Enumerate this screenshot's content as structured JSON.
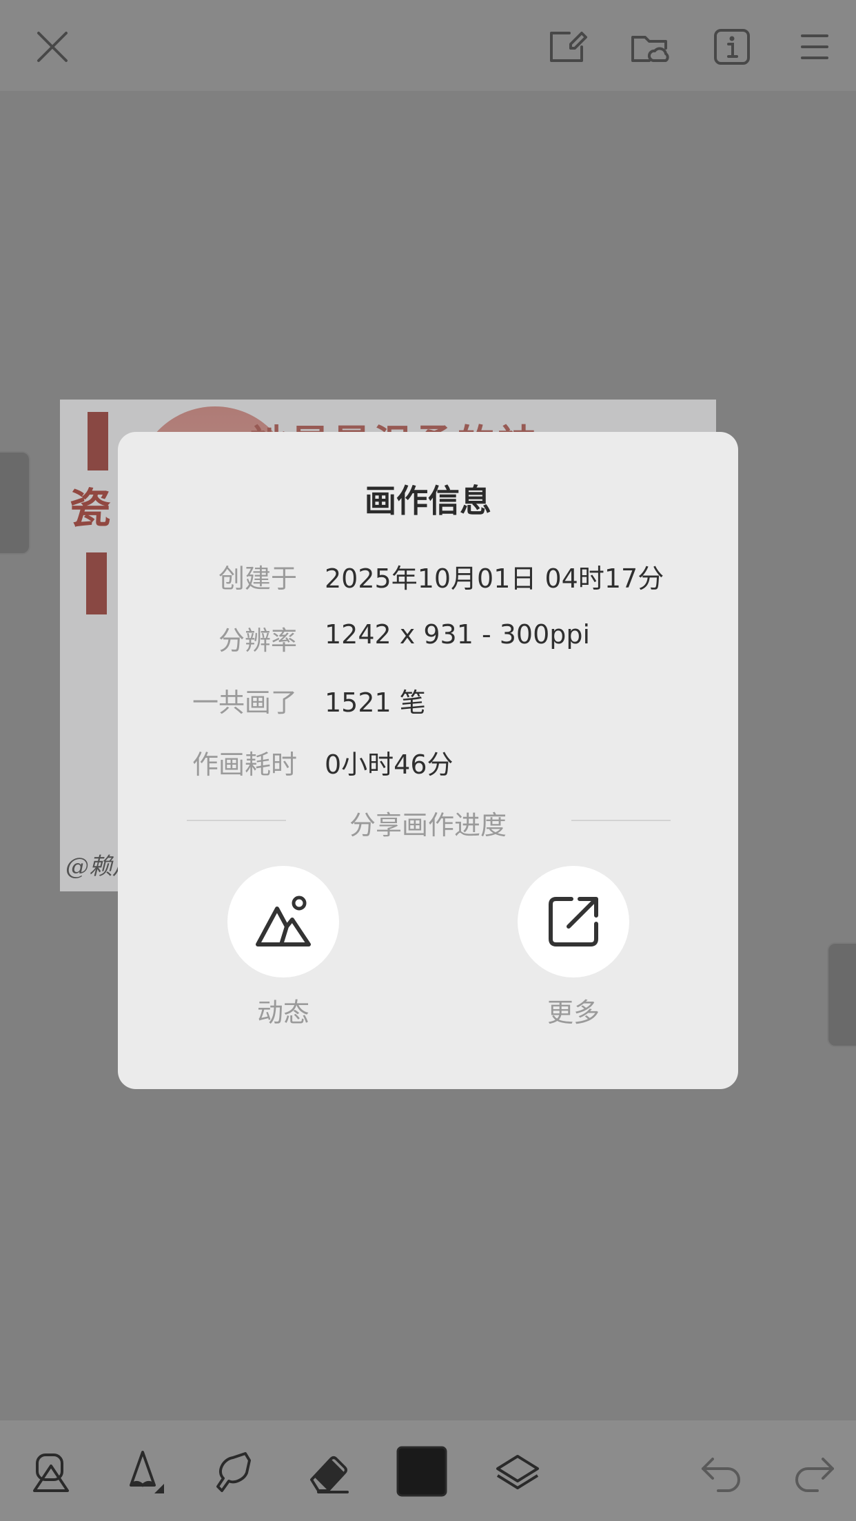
{
  "toolbar_top": {
    "icons": [
      "close-icon",
      "edit-canvas-icon",
      "cloud-folder-icon",
      "info-icon",
      "menu-icon"
    ]
  },
  "artwork": {
    "headline": "祂是最温柔的神",
    "red_char": "瓷",
    "signature": "@赖川馆"
  },
  "dialog": {
    "title": "画作信息",
    "rows": [
      {
        "label": "创建于",
        "value": "2025年10月01日 04时17分"
      },
      {
        "label": "分辨率",
        "value": "1242 x 931 - 300ppi"
      },
      {
        "label": "一共画了",
        "value": "1521 笔"
      },
      {
        "label": "作画耗时",
        "value": "0小时46分"
      }
    ],
    "share_section_title": "分享画作进度",
    "share_buttons": [
      {
        "label": "动态",
        "icon": "mountain-image-icon"
      },
      {
        "label": "更多",
        "icon": "external-share-icon"
      }
    ]
  },
  "toolbar_bottom": {
    "icons": [
      "shapes-icon",
      "pencil-icon",
      "smudge-icon",
      "eraser-icon",
      "color-swatch",
      "layers-icon",
      "undo-icon",
      "redo-icon"
    ],
    "current_color": "#1a1a1a"
  }
}
